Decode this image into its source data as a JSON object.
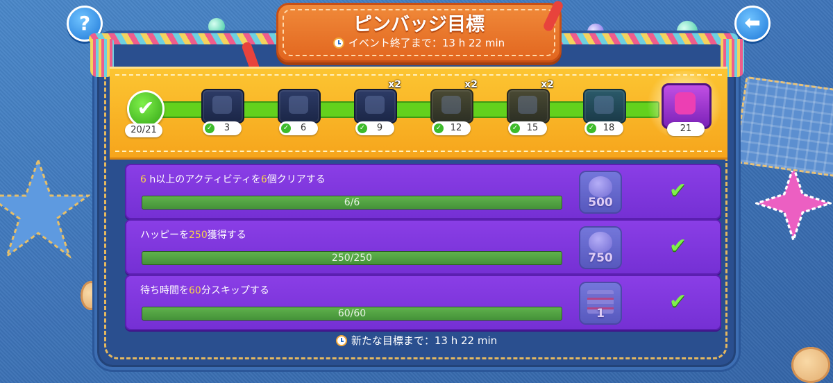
{
  "header": {
    "title": "ピンバッジ目標",
    "event_timer": "イベント終了まで：13 h 22 min",
    "help_label": "?",
    "back_label": "⬅"
  },
  "progress": {
    "current_label": "20/21",
    "current": 20,
    "target": 21,
    "milestones": [
      {
        "label": "3",
        "multiplier": ""
      },
      {
        "label": "6",
        "multiplier": ""
      },
      {
        "label": "9",
        "multiplier": "x2"
      },
      {
        "label": "12",
        "multiplier": "x2"
      },
      {
        "label": "15",
        "multiplier": "x2"
      },
      {
        "label": "18",
        "multiplier": ""
      }
    ],
    "final_label": "21"
  },
  "tasks": [
    {
      "title_parts": [
        "6",
        " h以上のアクティビティを",
        "6",
        "個クリアする"
      ],
      "progress_label": "6/6",
      "progress": 1.0,
      "reward_amount": "500",
      "reward_icon": "potion-icon"
    },
    {
      "title_parts": [
        "ハッピーを",
        "250",
        "獲得する"
      ],
      "progress_label": "250/250",
      "progress": 1.0,
      "reward_amount": "750",
      "reward_icon": "potion-icon"
    },
    {
      "title_parts": [
        "待ち時間を",
        "60",
        "分スキップする"
      ],
      "progress_label": "60/60",
      "progress": 1.0,
      "reward_amount": "1",
      "reward_icon": "book-stack-icon"
    }
  ],
  "footer": {
    "new_goal_timer": "新たな目標まで：13 h 22 min"
  },
  "colors": {
    "task_background": "#7f37de",
    "highlight_number": "#f7d34a",
    "banner": "#f8b323",
    "track": "#63d11d"
  }
}
